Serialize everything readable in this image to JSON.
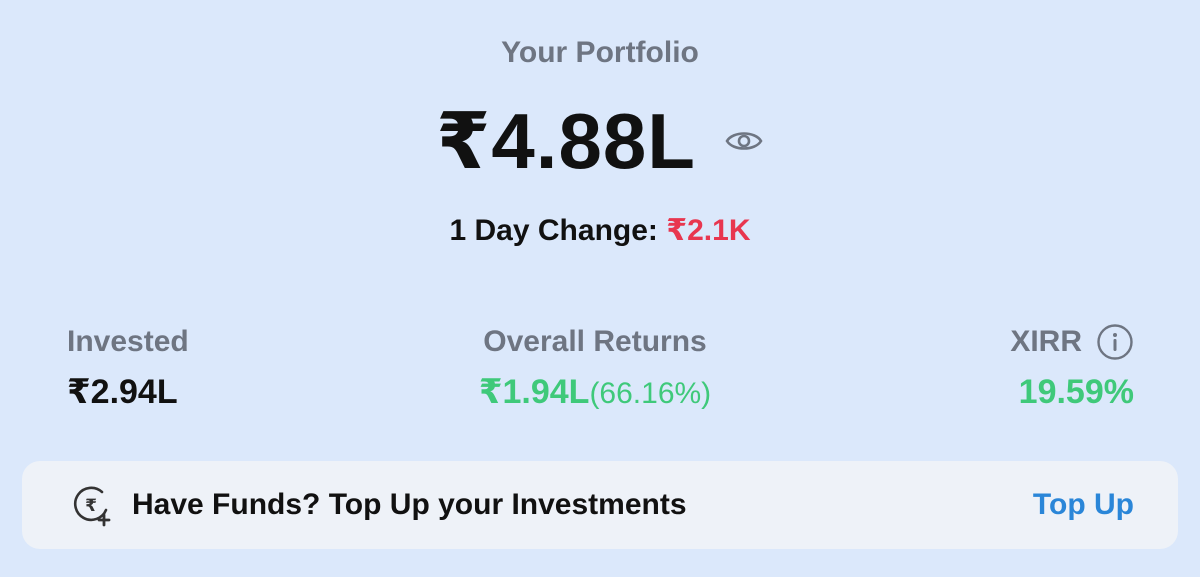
{
  "header": {
    "title": "Your Portfolio"
  },
  "portfolio": {
    "value": "₹4.88L",
    "visibility_icon": "eye-icon",
    "day_change_label": "1 Day Change: ",
    "day_change_value": "₹2.1K"
  },
  "stats": {
    "invested": {
      "label": "Invested",
      "value": "₹2.94L"
    },
    "returns": {
      "label": "Overall Returns",
      "value": "₹1.94L",
      "percent": "(66.16%)"
    },
    "xirr": {
      "label": "XIRR",
      "value": "19.59%",
      "info_icon": "info-icon"
    }
  },
  "topup_card": {
    "icon": "rupee-plus-icon",
    "message": "Have Funds? Top Up your Investments",
    "action_label": "Top Up"
  },
  "colors": {
    "background": "#dbe8fb",
    "negative": "#e8364f",
    "positive": "#3fc97a",
    "link": "#2a86d8",
    "muted": "#6e7582"
  }
}
